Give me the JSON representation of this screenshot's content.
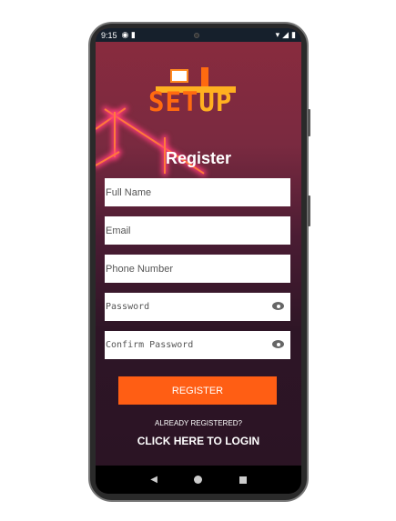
{
  "status_bar": {
    "time": "9:15"
  },
  "logo": {
    "text_a": "SET",
    "text_b": "UP"
  },
  "title": "Register",
  "fields": [
    {
      "placeholder": "Full Name",
      "value": ""
    },
    {
      "placeholder": "Email",
      "value": ""
    },
    {
      "placeholder": "Phone Number",
      "value": ""
    },
    {
      "placeholder": "Password",
      "value": "",
      "icon": "eye-icon"
    },
    {
      "placeholder": "Confirm Password",
      "value": "",
      "icon": "eye-icon"
    }
  ],
  "register_label": "REGISTER",
  "already_text": "ALREADY REGISTERED?",
  "login_link": "CLICK HERE TO LOGIN",
  "colors": {
    "accent": "#ff5e14",
    "status_bar": "#16202c"
  }
}
